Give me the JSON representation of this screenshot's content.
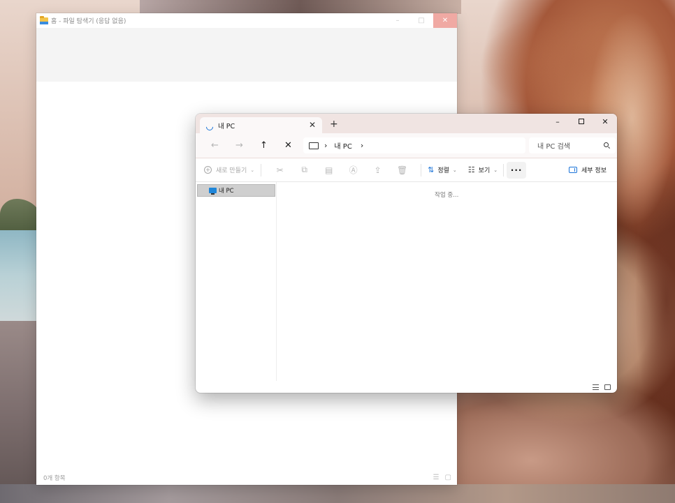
{
  "background_window": {
    "title": "홈 - 파일 탐색기 (응답 없음)",
    "status_text": "0개 항목",
    "controls": {
      "minimize": "–",
      "maximize": "□",
      "close": "✕"
    }
  },
  "window": {
    "tab": {
      "label": "내 PC",
      "close": "✕"
    },
    "new_tab": "+",
    "controls": {
      "minimize": "–",
      "close": "✕"
    },
    "nav": {
      "back": "←",
      "forward": "→",
      "up": "↑",
      "stop": "✕"
    },
    "address": {
      "separator": "›",
      "crumbs": [
        "내 PC"
      ],
      "trailing_separator": "›"
    },
    "search": {
      "placeholder": "내 PC 검색"
    },
    "toolbar": {
      "new_label": "새로 만들기",
      "sort_label": "정렬",
      "view_label": "보기",
      "more_label": "···",
      "details_label": "세부 정보"
    },
    "sidebar": {
      "items": [
        {
          "label": "내 PC",
          "selected": true
        }
      ]
    },
    "loading_text": "작업 중..."
  },
  "colors": {
    "accent": "#1a73d8",
    "tabbar_bg": "#f0e4e2",
    "selected_item_bg": "#cfcfcf"
  }
}
